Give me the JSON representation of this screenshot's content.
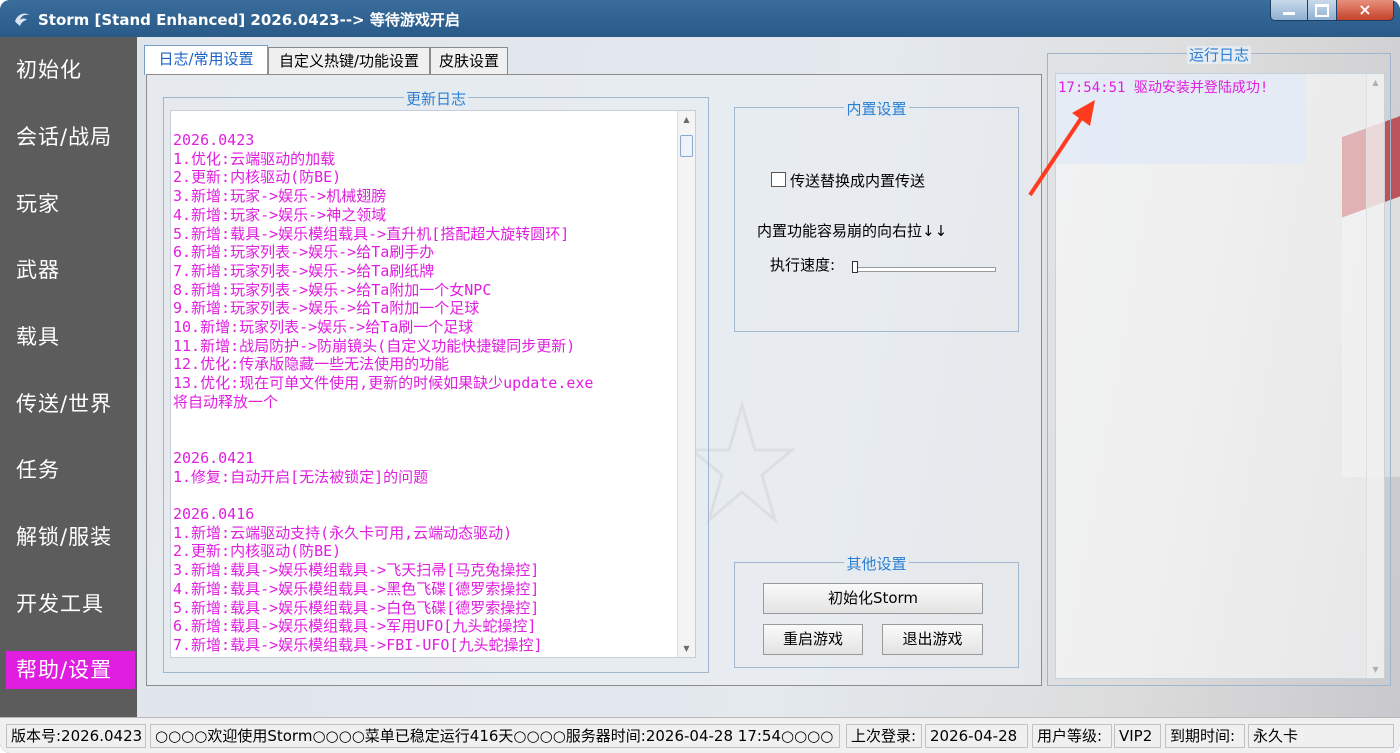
{
  "window": {
    "title": "Storm [Stand Enhanced] 2026.0423--> 等待游戏开启",
    "controls": {
      "close": "×"
    }
  },
  "sidebar": {
    "items": [
      {
        "label": "初始化"
      },
      {
        "label": "会话/战局"
      },
      {
        "label": "玩家"
      },
      {
        "label": "武器"
      },
      {
        "label": "载具"
      },
      {
        "label": "传送/世界"
      },
      {
        "label": "任务"
      },
      {
        "label": "解锁/服装"
      },
      {
        "label": "开发工具"
      },
      {
        "label": "帮助/设置"
      }
    ],
    "active_index": 9,
    "active_color": "#e01ee0"
  },
  "tabs": [
    {
      "label": "日志/常用设置"
    },
    {
      "label": "自定义热键/功能设置"
    },
    {
      "label": "皮肤设置"
    }
  ],
  "update_log": {
    "title": "更新日志",
    "text_color": "#e01ee0",
    "lines": [
      "2026.0423",
      "1.优化:云端驱动的加载",
      "2.更新:内核驱动(防BE)",
      "3.新增:玩家->娱乐->机械翅膀",
      "4.新增:玩家->娱乐->神之领域",
      "5.新增:载具->娱乐模组载具->直升机[搭配超大旋转圆环]",
      "6.新增:玩家列表->娱乐->给Ta刷手办",
      "7.新增:玩家列表->娱乐->给Ta刷纸牌",
      "8.新增:玩家列表->娱乐->给Ta附加一个女NPC",
      "9.新增:玩家列表->娱乐->给Ta附加一个足球",
      "10.新增:玩家列表->娱乐->给Ta刷一个足球",
      "11.新增:战局防护->防崩镜头(自定义功能快捷键同步更新)",
      "12.优化:传承版隐藏一些无法使用的功能",
      "13.优化:现在可单文件使用,更新的时候如果缺少update.exe",
      "将自动释放一个",
      "",
      "",
      "2026.0421",
      "1.修复:自动开启[无法被锁定]的问题",
      "",
      "2026.0416",
      "1.新增:云端驱动支持(永久卡可用,云端动态驱动)",
      "2.更新:内核驱动(防BE)",
      "3.新增:载具->娱乐模组载具->飞天扫帚[马克兔操控]",
      "4.新增:载具->娱乐模组载具->黑色飞碟[德罗索操控]",
      "5.新增:载具->娱乐模组载具->白色飞碟[德罗索操控]",
      "6.新增:载具->娱乐模组载具->军用UFO[九头蛇操控]",
      "7.新增:载具->娱乐模组载具->FBI-UFO[九头蛇操控]"
    ]
  },
  "builtin": {
    "title": "内置设置",
    "checkbox_label": "传送替换成内置传送",
    "checkbox_checked": false,
    "hint": "内置功能容易崩的向右拉↓↓",
    "speed_label": "执行速度:",
    "speed_value": 0
  },
  "other": {
    "title": "其他设置",
    "init_button": "初始化Storm",
    "restart_button": "重启游戏",
    "exit_button": "退出游戏"
  },
  "run_log": {
    "title": "运行日志",
    "entries": [
      {
        "text": "17:54:51 驱动安装并登陆成功!"
      }
    ]
  },
  "statusbar": {
    "version": "版本号:2026.0423",
    "marquee": "○○○○欢迎使用Storm○○○○菜单已稳定运行416天○○○○服务器时间:2026-04-28 17:54○○○○",
    "last_login_label": "上次登录:",
    "last_login_value": "2026-04-28",
    "level_label": "用户等级:",
    "level_value": "VIP2",
    "expire_label": "到期时间:",
    "expire_value": "永久卡"
  }
}
